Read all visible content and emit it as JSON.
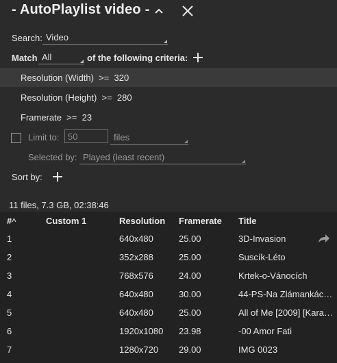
{
  "titlebar": {
    "title": "- AutoPlaylist video -"
  },
  "search": {
    "label": "Search:",
    "value": "Video"
  },
  "match": {
    "label": "Match",
    "value": "All",
    "suffix": "of the following criteria:"
  },
  "criteria": [
    {
      "text": "Resolution (Width)  >=  320",
      "selected": true
    },
    {
      "text": "Resolution (Height)  >=  280",
      "selected": false
    },
    {
      "text": "Framerate  >=  23",
      "selected": false
    }
  ],
  "limit": {
    "label": "Limit to:",
    "value": "50",
    "unit": "files"
  },
  "selected_by": {
    "label": "Selected by:",
    "value": "Played (least recent)"
  },
  "sort_by": {
    "label": "Sort by:"
  },
  "summary": "11 files, 7.3 GB, 02:38:46",
  "table": {
    "headers": {
      "num": "#",
      "sort_caret": "^",
      "custom1": "Custom 1",
      "resolution": "Resolution",
      "framerate": "Framerate",
      "title": "Title"
    },
    "rows": [
      {
        "num": "1",
        "custom1": "",
        "resolution": "640x480",
        "framerate": "25.00",
        "title": "3D-Invasion"
      },
      {
        "num": "2",
        "custom1": "",
        "resolution": "352x288",
        "framerate": "25.00",
        "title": "Suscík-Léto"
      },
      {
        "num": "3",
        "custom1": "",
        "resolution": "768x576",
        "framerate": "24.00",
        "title": "Krtek-o-Vánocích"
      },
      {
        "num": "4",
        "custom1": "",
        "resolution": "640x480",
        "framerate": "30.00",
        "title": "44-PS-Na Zlámankác…"
      },
      {
        "num": "5",
        "custom1": "",
        "resolution": "640x480",
        "framerate": "25.00",
        "title": "All of Me [2009] [Kara…"
      },
      {
        "num": "6",
        "custom1": "",
        "resolution": "1920x1080",
        "framerate": "23.98",
        "title": "-00 Amor Fati"
      },
      {
        "num": "7",
        "custom1": "",
        "resolution": "1280x720",
        "framerate": "29.00",
        "title": "IMG 0023"
      }
    ]
  },
  "colors": {
    "background": "#2b2b2b",
    "selected_row": "#3a3a3a",
    "table_bg": "#222222",
    "text": "#e6e6e6"
  }
}
